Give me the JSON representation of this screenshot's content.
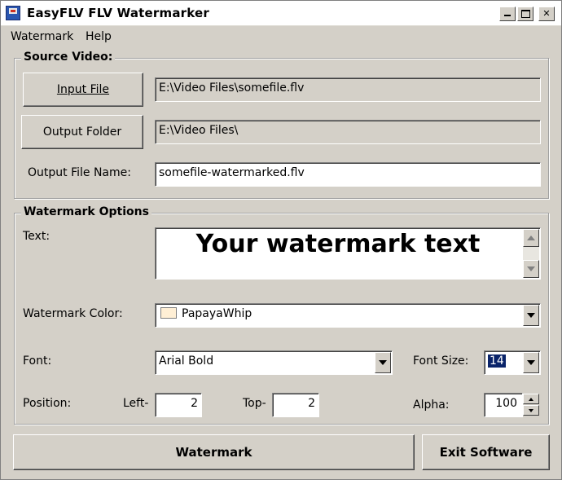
{
  "window": {
    "title": "EasyFLV FLV Watermarker"
  },
  "menu": {
    "items": [
      "Watermark",
      "Help"
    ]
  },
  "source": {
    "legend": "Source Video:",
    "input_button": "Input File",
    "input_value": "E:\\Video Files\\somefile.flv",
    "output_button": "Output Folder",
    "output_value": "E:\\Video Files\\",
    "output_name_label": "Output File Name:",
    "output_name_value": "somefile-watermarked.flv"
  },
  "options": {
    "legend": "Watermark Options",
    "text_label": "Text:",
    "text_value": "Your watermark text",
    "color_label": "Watermark Color:",
    "color_value": "PapayaWhip",
    "color_hex": "#ffefd5",
    "font_label": "Font:",
    "font_value": "Arial Bold",
    "font_size_label": "Font Size:",
    "font_size_value": "14",
    "position_label": "Position:",
    "left_label": "Left-",
    "left_value": "2",
    "top_label": "Top-",
    "top_value": "2",
    "alpha_label": "Alpha:",
    "alpha_value": "100"
  },
  "actions": {
    "watermark_button": "Watermark",
    "exit_button": "Exit Software"
  }
}
